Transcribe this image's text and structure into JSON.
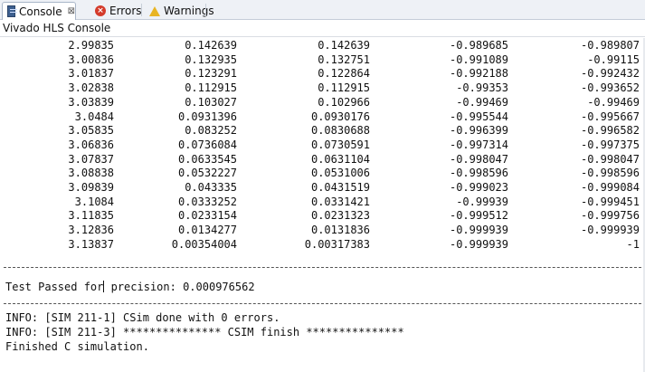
{
  "tabs": [
    {
      "label": "Console",
      "close": "⊠",
      "icon": "console-icon"
    },
    {
      "label": "Errors",
      "icon": "errors-icon"
    },
    {
      "label": "Warnings",
      "icon": "warnings-icon"
    }
  ],
  "console": {
    "title": "Vivado HLS Console",
    "rows": [
      [
        "2.99835",
        "0.142639",
        "0.142639",
        "-0.989685",
        "-0.989807"
      ],
      [
        "3.00836",
        "0.132935",
        "0.132751",
        "-0.991089",
        "-0.99115"
      ],
      [
        "3.01837",
        "0.123291",
        "0.122864",
        "-0.992188",
        "-0.992432"
      ],
      [
        "3.02838",
        "0.112915",
        "0.112915",
        "-0.99353",
        "-0.993652"
      ],
      [
        "3.03839",
        "0.103027",
        "0.102966",
        "-0.99469",
        "-0.99469"
      ],
      [
        "3.0484",
        "0.0931396",
        "0.0930176",
        "-0.995544",
        "-0.995667"
      ],
      [
        "3.05835",
        "0.083252",
        "0.0830688",
        "-0.996399",
        "-0.996582"
      ],
      [
        "3.06836",
        "0.0736084",
        "0.0730591",
        "-0.997314",
        "-0.997375"
      ],
      [
        "3.07837",
        "0.0633545",
        "0.0631104",
        "-0.998047",
        "-0.998047"
      ],
      [
        "3.08838",
        "0.0532227",
        "0.0531006",
        "-0.998596",
        "-0.998596"
      ],
      [
        "3.09839",
        "0.043335",
        "0.0431519",
        "-0.999023",
        "-0.999084"
      ],
      [
        "3.1084",
        "0.0333252",
        "0.0331421",
        "-0.99939",
        "-0.999451"
      ],
      [
        "3.11835",
        "0.0233154",
        "0.0231323",
        "-0.999512",
        "-0.999756"
      ],
      [
        "3.12836",
        "0.0134277",
        "0.0131836",
        "-0.999939",
        "-0.999939"
      ],
      [
        "3.13837",
        "0.00354004",
        "0.00317383",
        "-0.999939",
        "-1"
      ]
    ],
    "divider": "-----------------------------------------------------------------------------------------------",
    "test_prefix": "Test Passed for",
    "test_suffix": " precision: 0.000976562",
    "info_lines": [
      "INFO: [SIM 211-1] CSim done with 0 errors.",
      "INFO: [SIM 211-3] *************** CSIM finish ***************",
      "Finished C simulation."
    ]
  }
}
